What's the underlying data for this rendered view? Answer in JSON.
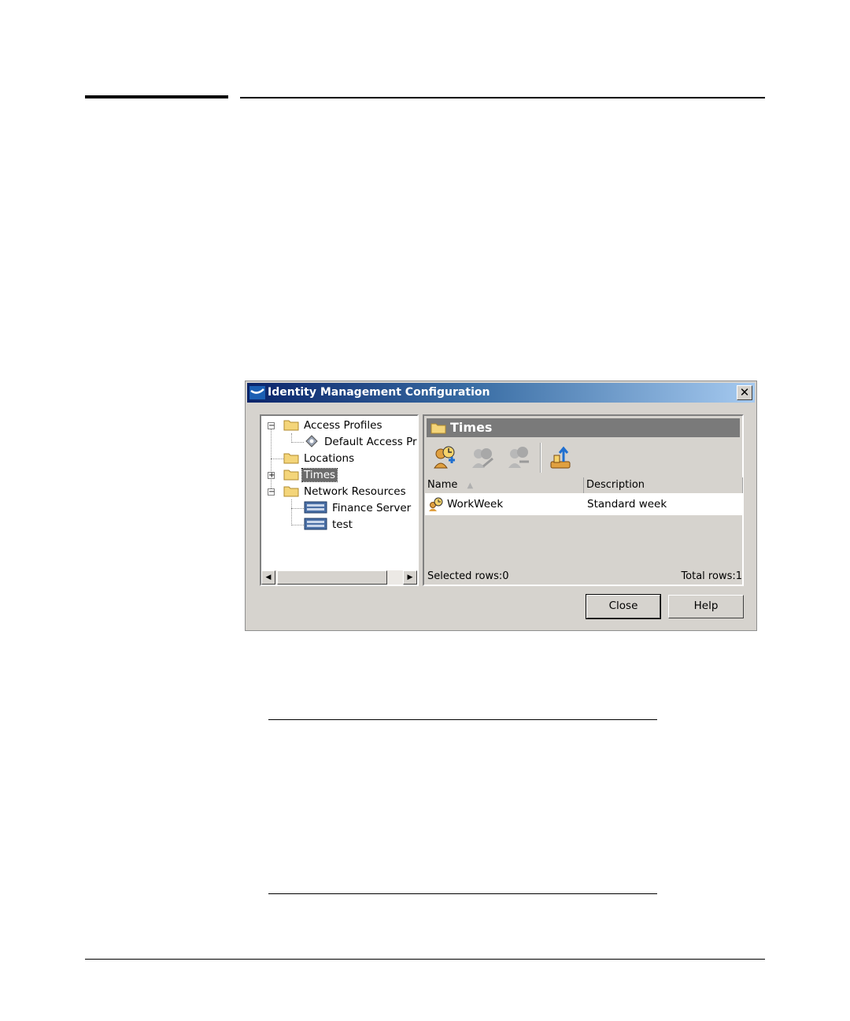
{
  "dialog": {
    "title": "Identity Management Configuration",
    "close_glyph": "✕"
  },
  "tree": {
    "items": [
      {
        "label": "Access Profiles",
        "icon": "folder-icon",
        "expander": "−"
      },
      {
        "label": "Default Access Pro",
        "icon": "profile-icon"
      },
      {
        "label": "Locations",
        "icon": "folder-icon"
      },
      {
        "label": "Times",
        "icon": "folder-icon",
        "expander": "+",
        "selected": true
      },
      {
        "label": "Network Resources",
        "icon": "folder-icon",
        "expander": "−"
      },
      {
        "label": "Finance Server",
        "icon": "server-icon"
      },
      {
        "label": "test",
        "icon": "server-icon"
      }
    ],
    "scroll_left": "◀",
    "scroll_right": "▶"
  },
  "panel": {
    "title": "Times",
    "toolbar": [
      {
        "name": "add-time-icon",
        "enabled": true
      },
      {
        "name": "edit-time-icon",
        "enabled": false
      },
      {
        "name": "delete-time-icon",
        "enabled": false
      },
      {
        "name": "import-icon",
        "enabled": true
      }
    ],
    "columns": [
      "Name",
      "Description"
    ],
    "sort_indicator": "▲",
    "rows": [
      {
        "name": "WorkWeek",
        "description": "Standard week"
      }
    ],
    "selected_rows": "Selected rows:0",
    "total_rows": "Total rows:1"
  },
  "buttons": {
    "close": "Close",
    "help": "Help"
  },
  "colors": {
    "title_start": "#0a246a",
    "title_end": "#a6caf0",
    "dialog_bg": "#d6d3ce",
    "header_bg": "#7a7a7a"
  }
}
